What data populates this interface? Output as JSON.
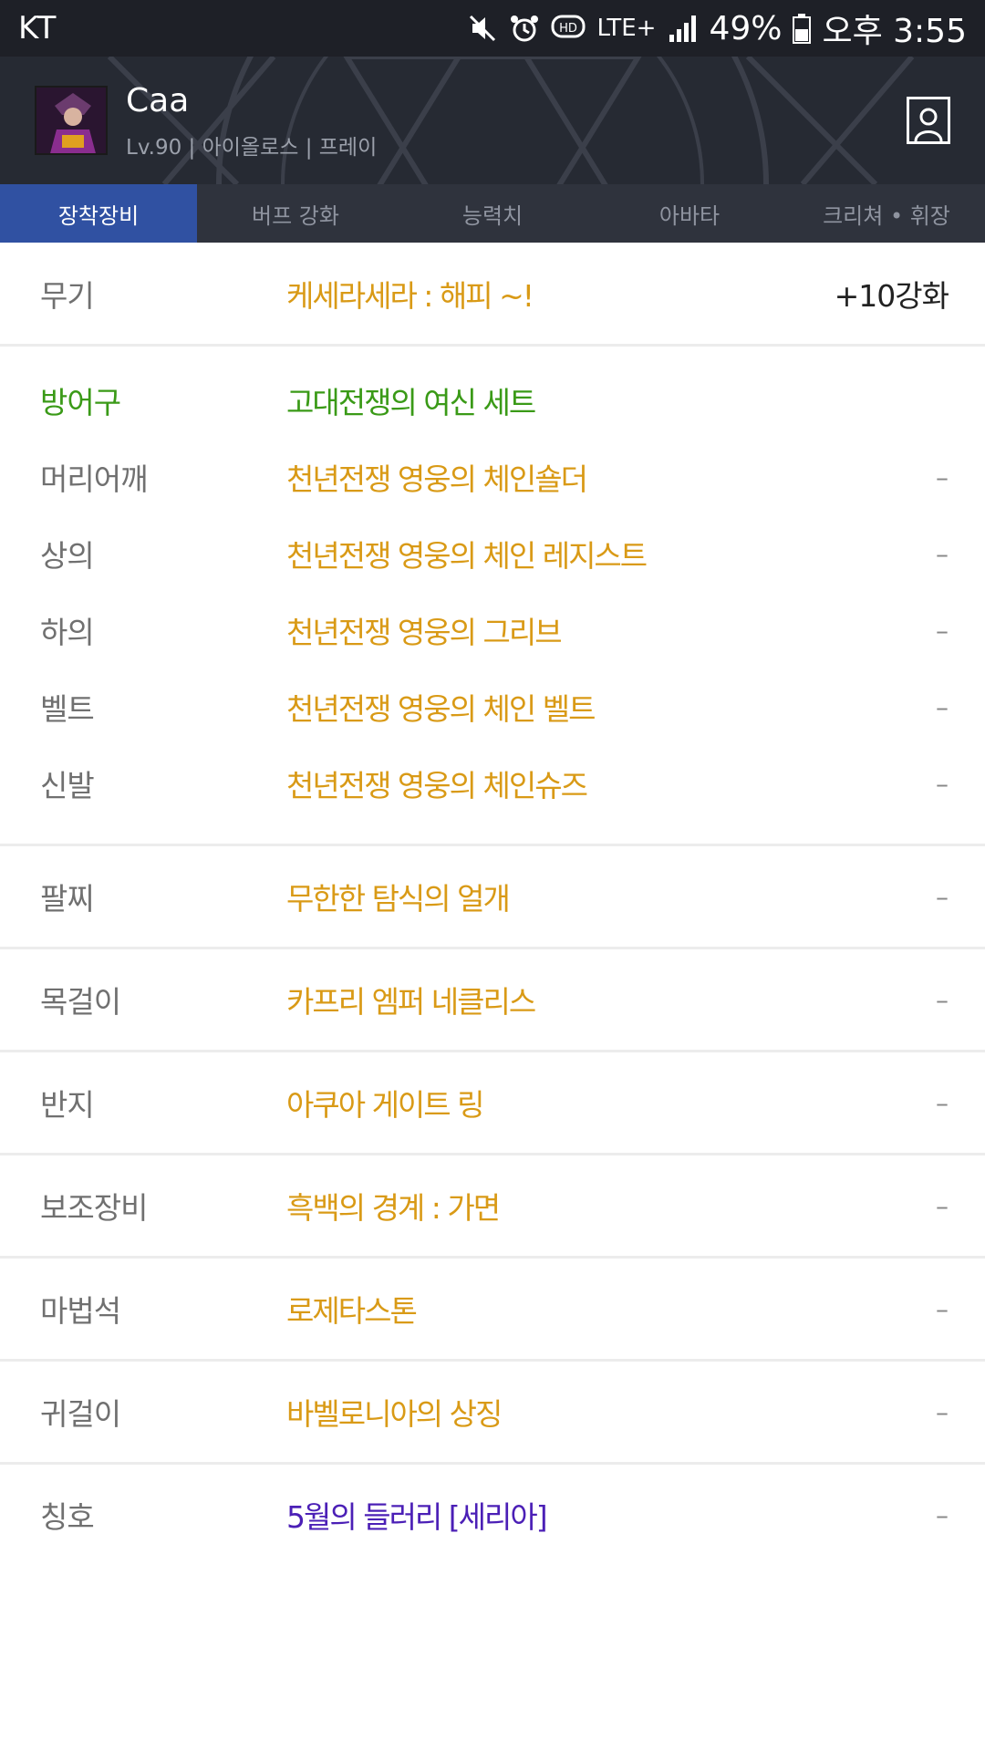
{
  "status_bar": {
    "carrier": "KT",
    "battery": "49%",
    "time": "오후 3:55",
    "network": "LTE+"
  },
  "profile": {
    "name": "Caa",
    "subtitle": "Lv.90 | 아이올로스 | 프레이"
  },
  "tabs": [
    {
      "label": "장착장비",
      "active": true
    },
    {
      "label": "버프 강화",
      "active": false
    },
    {
      "label": "능력치",
      "active": false
    },
    {
      "label": "아바타",
      "active": false
    },
    {
      "label": "크리쳐 • 휘장",
      "active": false
    }
  ],
  "equipment": {
    "weapon": {
      "slot": "무기",
      "item": "케세라세라 : 해피 ~!",
      "enhance": "+10강화"
    },
    "armor_set": {
      "slot": "방어구",
      "item": "고대전쟁의 여신 세트"
    },
    "armor": [
      {
        "slot": "머리어깨",
        "item": "천년전쟁 영웅의 체인숄더",
        "enhance": "–"
      },
      {
        "slot": "상의",
        "item": "천년전쟁 영웅의 체인 레지스트",
        "enhance": "–"
      },
      {
        "slot": "하의",
        "item": "천년전쟁 영웅의 그리브",
        "enhance": "–"
      },
      {
        "slot": "벨트",
        "item": "천년전쟁 영웅의 체인 벨트",
        "enhance": "–"
      },
      {
        "slot": "신발",
        "item": "천년전쟁 영웅의 체인슈즈",
        "enhance": "–"
      }
    ],
    "accessories": [
      {
        "slot": "팔찌",
        "item": "무한한 탐식의 얼개",
        "enhance": "–"
      },
      {
        "slot": "목걸이",
        "item": "카프리 엠퍼 네클리스",
        "enhance": "–"
      },
      {
        "slot": "반지",
        "item": "아쿠아 게이트 링",
        "enhance": "–"
      },
      {
        "slot": "보조장비",
        "item": "흑백의 경계 : 가면",
        "enhance": "–"
      },
      {
        "slot": "마법석",
        "item": "로제타스톤",
        "enhance": "–"
      },
      {
        "slot": "귀걸이",
        "item": "바벨로니아의 상징",
        "enhance": "–"
      }
    ],
    "title": {
      "slot": "칭호",
      "item": "5월의 들러리 [세리아]",
      "enhance": "–"
    }
  },
  "colors": {
    "status_bar_bg": "#1e2027",
    "header_bg": "#262a33",
    "tab_bg": "#2f333d",
    "tab_active_bg": "#3051a2",
    "item_unique": "#d99a16",
    "set_green": "#3a9a17",
    "title_purple": "#4b1fb6"
  }
}
